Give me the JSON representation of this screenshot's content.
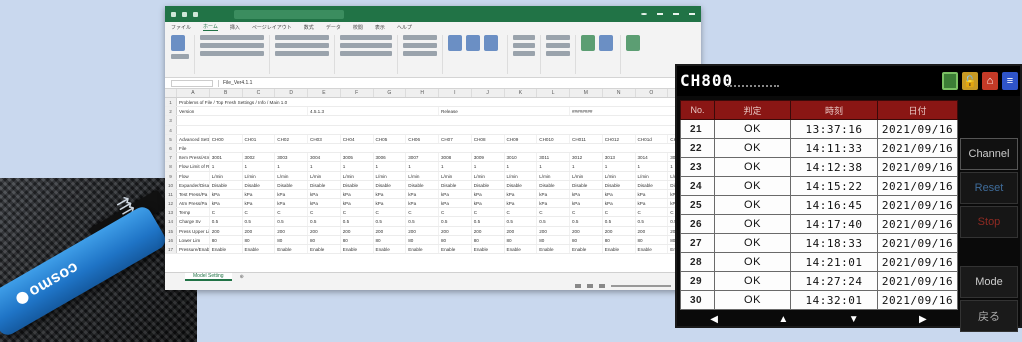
{
  "usb": {
    "brand": "cosmo",
    "symbol_icon": "usb-icon"
  },
  "excel": {
    "formula": "File_Ver4.1.1",
    "menu": [
      "ファイル",
      "ホーム",
      "挿入",
      "ページレイアウト",
      "数式",
      "データ",
      "校閲",
      "表示",
      "ヘルプ"
    ],
    "columns": [
      "",
      "A",
      "B",
      "C",
      "D",
      "E",
      "F",
      "G",
      "H",
      "I",
      "J",
      "K",
      "L",
      "M",
      "N",
      "O",
      "P"
    ],
    "row1": "Problems of File / Top Fresh Settings / Info / Main 1.0",
    "version_label": "Version",
    "version": "4.5.1.3",
    "release_label": "Release",
    "release_value": "########",
    "adv_label": "Advanced Settings",
    "channels": [
      "CH00",
      "CH01",
      "CH02",
      "CH03",
      "CH04",
      "CH05",
      "CH06",
      "CH07",
      "CH08",
      "CH09",
      "CH010",
      "CH011",
      "CH012",
      "CH01d",
      "CH01"
    ],
    "file_label": "File",
    "item_label": "Item Press/Atm Press",
    "item_values": [
      "3001",
      "3002",
      "3003",
      "3004",
      "3005",
      "3006",
      "3007",
      "3008",
      "3009",
      "3010",
      "3011",
      "3012",
      "3013",
      "3014",
      "3015"
    ],
    "flow_label": "Flow Limit of Range",
    "flow_values": [
      "1",
      "1",
      "1",
      "1",
      "1",
      "1",
      "1",
      "1",
      "1",
      "1",
      "1",
      "1",
      "1",
      "1",
      "1"
    ],
    "rows": [
      {
        "label": "Flow",
        "values": [
          "L/min",
          "L/min",
          "L/min",
          "L/min",
          "L/min",
          "L/min",
          "L/min",
          "L/min",
          "L/min",
          "L/min",
          "L/min",
          "L/min",
          "L/min",
          "L/min",
          "L/min"
        ]
      },
      {
        "label": "Expander/Disable",
        "values": [
          "Disable",
          "Disable",
          "Disable",
          "Disable",
          "Disable",
          "Disable",
          "Disable",
          "Disable",
          "Disable",
          "Disable",
          "Disable",
          "Disable",
          "Disable",
          "Disable",
          "Disable"
        ]
      },
      {
        "label": "Test Press/Pa",
        "values": [
          "kPa",
          "kPa",
          "kPa",
          "kPa",
          "kPa",
          "kPa",
          "kPa",
          "kPa",
          "kPa",
          "kPa",
          "kPa",
          "kPa",
          "kPa",
          "kPa",
          "kPa"
        ]
      },
      {
        "label": "Atm Press/Pa",
        "values": [
          "kPa",
          "kPa",
          "kPa",
          "kPa",
          "kPa",
          "kPa",
          "kPa",
          "kPa",
          "kPa",
          "kPa",
          "kPa",
          "kPa",
          "kPa",
          "kPa",
          "kPa"
        ]
      },
      {
        "label": "Temp",
        "values": [
          "C",
          "C",
          "C",
          "C",
          "C",
          "C",
          "C",
          "C",
          "C",
          "C",
          "C",
          "C",
          "C",
          "C",
          "C"
        ]
      },
      {
        "label": "Charge Sv",
        "values": [
          "0.5",
          "0.5",
          "0.5",
          "0.5",
          "0.5",
          "0.5",
          "0.5",
          "0.5",
          "0.5",
          "0.5",
          "0.5",
          "0.5",
          "0.5",
          "0.5",
          "0.5"
        ]
      },
      {
        "label": "Press Upper Lim",
        "values": [
          "200",
          "200",
          "200",
          "200",
          "200",
          "200",
          "200",
          "200",
          "200",
          "200",
          "200",
          "200",
          "200",
          "200",
          "200"
        ]
      },
      {
        "label": "Lower Lim",
        "values": [
          "80",
          "80",
          "80",
          "80",
          "80",
          "80",
          "80",
          "80",
          "80",
          "80",
          "80",
          "80",
          "80",
          "80",
          "80"
        ]
      },
      {
        "label": "Pressure/Enable",
        "values": [
          "Enable",
          "Enable",
          "Enable",
          "Enable",
          "Enable",
          "Enable",
          "Enable",
          "Enable",
          "Enable",
          "Enable",
          "Enable",
          "Enable",
          "Enable",
          "Enable",
          "Enable"
        ]
      }
    ],
    "sheet_tab": "Model Setting"
  },
  "hmi": {
    "channel": "CH800",
    "headers": {
      "no": "No.",
      "judge": "判定",
      "time": "時刻",
      "date": "日付"
    },
    "records": [
      {
        "no": "21",
        "judge": "OK",
        "time": "13:37:16",
        "date": "2021/09/16"
      },
      {
        "no": "22",
        "judge": "OK",
        "time": "14:11:33",
        "date": "2021/09/16"
      },
      {
        "no": "23",
        "judge": "OK",
        "time": "14:12:38",
        "date": "2021/09/16"
      },
      {
        "no": "24",
        "judge": "OK",
        "time": "14:15:22",
        "date": "2021/09/16"
      },
      {
        "no": "25",
        "judge": "OK",
        "time": "14:16:45",
        "date": "2021/09/16"
      },
      {
        "no": "26",
        "judge": "OK",
        "time": "14:17:40",
        "date": "2021/09/16"
      },
      {
        "no": "27",
        "judge": "OK",
        "time": "14:18:33",
        "date": "2021/09/16"
      },
      {
        "no": "28",
        "judge": "OK",
        "time": "14:21:01",
        "date": "2021/09/16"
      },
      {
        "no": "29",
        "judge": "OK",
        "time": "14:27:24",
        "date": "2021/09/16"
      },
      {
        "no": "30",
        "judge": "OK",
        "time": "14:32:01",
        "date": "2021/09/16"
      }
    ],
    "side": {
      "channel": "Channel",
      "reset": "Reset",
      "stop": "Stop",
      "mode": "Mode",
      "back": "戻る"
    },
    "nav": [
      "◀",
      "▲",
      "▼",
      "▶"
    ]
  }
}
